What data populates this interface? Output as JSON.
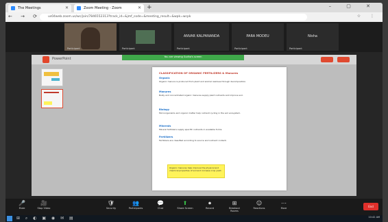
{
  "browser": {
    "tabs": [
      {
        "label": "The Meetings",
        "color": "#2d8cff"
      },
      {
        "label": "Zoom Meeting - Zoom",
        "color": "#2d8cff"
      }
    ],
    "new_tab": "+",
    "window_controls": "– ▢ ✕",
    "nav_icons": "← → ⟳",
    "url": "us04web.zoom.us/wc/join/7846552313?track_id=&jmf_code=&meeting_result=&wpk=wcpk",
    "extensions": "☆ ⋮"
  },
  "gallery": [
    {
      "name": "",
      "small": "Participant"
    },
    {
      "name": "",
      "small": "Participant"
    },
    {
      "name": "ANVAR KALPANANDA",
      "small": "Participant"
    },
    {
      "name": "PARA MODEU",
      "small": "Participant"
    },
    {
      "name": "Nisha",
      "small": "Participant"
    }
  ],
  "shared_screen": {
    "app_name": "PowerPoint",
    "share_banner": "You are viewing Sudha's screen",
    "slide": {
      "title": "CLASSIFICATION OF ORGANIC FERTILIZERS & Manures",
      "sections": [
        {
          "heading": "Organic",
          "text": "Organic manure is produced from plant and animal residues through decomposition."
        },
        {
          "heading": "Manures",
          "text": "Bulky and concentrated organic manures supply plant nutrients and improve soil."
        },
        {
          "heading": "Biology",
          "text": "Microorganisms and organic matter help nutrient cycling in the soil ecosystem."
        },
        {
          "heading": "Minerals",
          "text": "Mineral fertilizers supply specific nutrients in available forms."
        },
        {
          "heading": "Fertilizers",
          "text": "Fertilizers are classified according to source and nutrient content."
        }
      ],
      "highlight": "Organic manures help improve the physical and chemical properties of soil and increase crop yield."
    }
  },
  "toolbar": {
    "items": [
      {
        "icon": "🎤",
        "label": "Mute"
      },
      {
        "icon": "🎥",
        "label": "Stop Video"
      },
      {
        "icon": "🛡",
        "label": "Security"
      },
      {
        "icon": "👥",
        "label": "Participants"
      },
      {
        "icon": "💬",
        "label": "Chat"
      },
      {
        "icon": "⬆",
        "label": "Share Screen"
      },
      {
        "icon": "⏺",
        "label": "Record"
      },
      {
        "icon": "⊞",
        "label": "Breakout Rooms"
      },
      {
        "icon": "☺",
        "label": "Reactions"
      },
      {
        "icon": "⋯",
        "label": "More"
      }
    ],
    "end_label": "End"
  },
  "taskbar": {
    "icons": "⊞ ⌕ ◐ ▣ ◉ ✉ ▤",
    "time": "10:42 AM"
  }
}
